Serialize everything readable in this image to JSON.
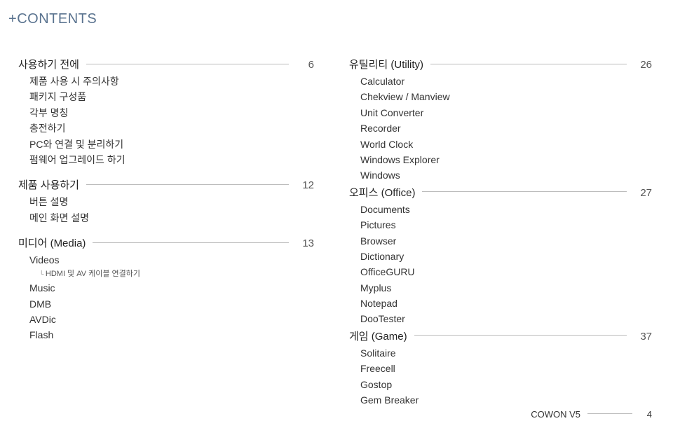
{
  "header": {
    "plus": "+",
    "title": "CONTENTS"
  },
  "left": [
    {
      "title": "사용하기 전에",
      "page": "6",
      "items": [
        "제품 사용 시 주의사항",
        "패키지 구성품",
        "각부 명칭",
        "충전하기",
        "PC와 연결 및 분리하기",
        "펌웨어 업그레이드 하기"
      ]
    },
    {
      "title": "제품 사용하기",
      "page": "12",
      "items": [
        "버튼 설명",
        "메인 화면 설명"
      ]
    },
    {
      "title": "미디어 (Media)",
      "page": "13",
      "items_custom": [
        {
          "label": "Videos",
          "sub": [
            "HDMI 및 AV 케이블 연결하기"
          ]
        },
        {
          "label": "Music"
        },
        {
          "label": "DMB"
        },
        {
          "label": "AVDic"
        },
        {
          "label": "Flash"
        }
      ]
    }
  ],
  "right": [
    {
      "title": "유틸리티 (Utility)",
      "page": "26",
      "items": [
        "Calculator",
        "Chekview / Manview",
        "Unit Converter",
        "Recorder",
        "World Clock",
        "Windows Explorer",
        "Windows"
      ]
    },
    {
      "title": "오피스 (Office)",
      "page": "27",
      "items": [
        "Documents",
        "Pictures",
        "Browser",
        "Dictionary",
        "OfficeGURU",
        "Myplus",
        "Notepad",
        "DooTester"
      ]
    },
    {
      "title": "게임 (Game)",
      "page": "37",
      "items": [
        "Solitaire",
        "Freecell",
        "Gostop",
        "Gem Breaker"
      ]
    }
  ],
  "footer": {
    "label": "COWON V5",
    "page": "4"
  }
}
